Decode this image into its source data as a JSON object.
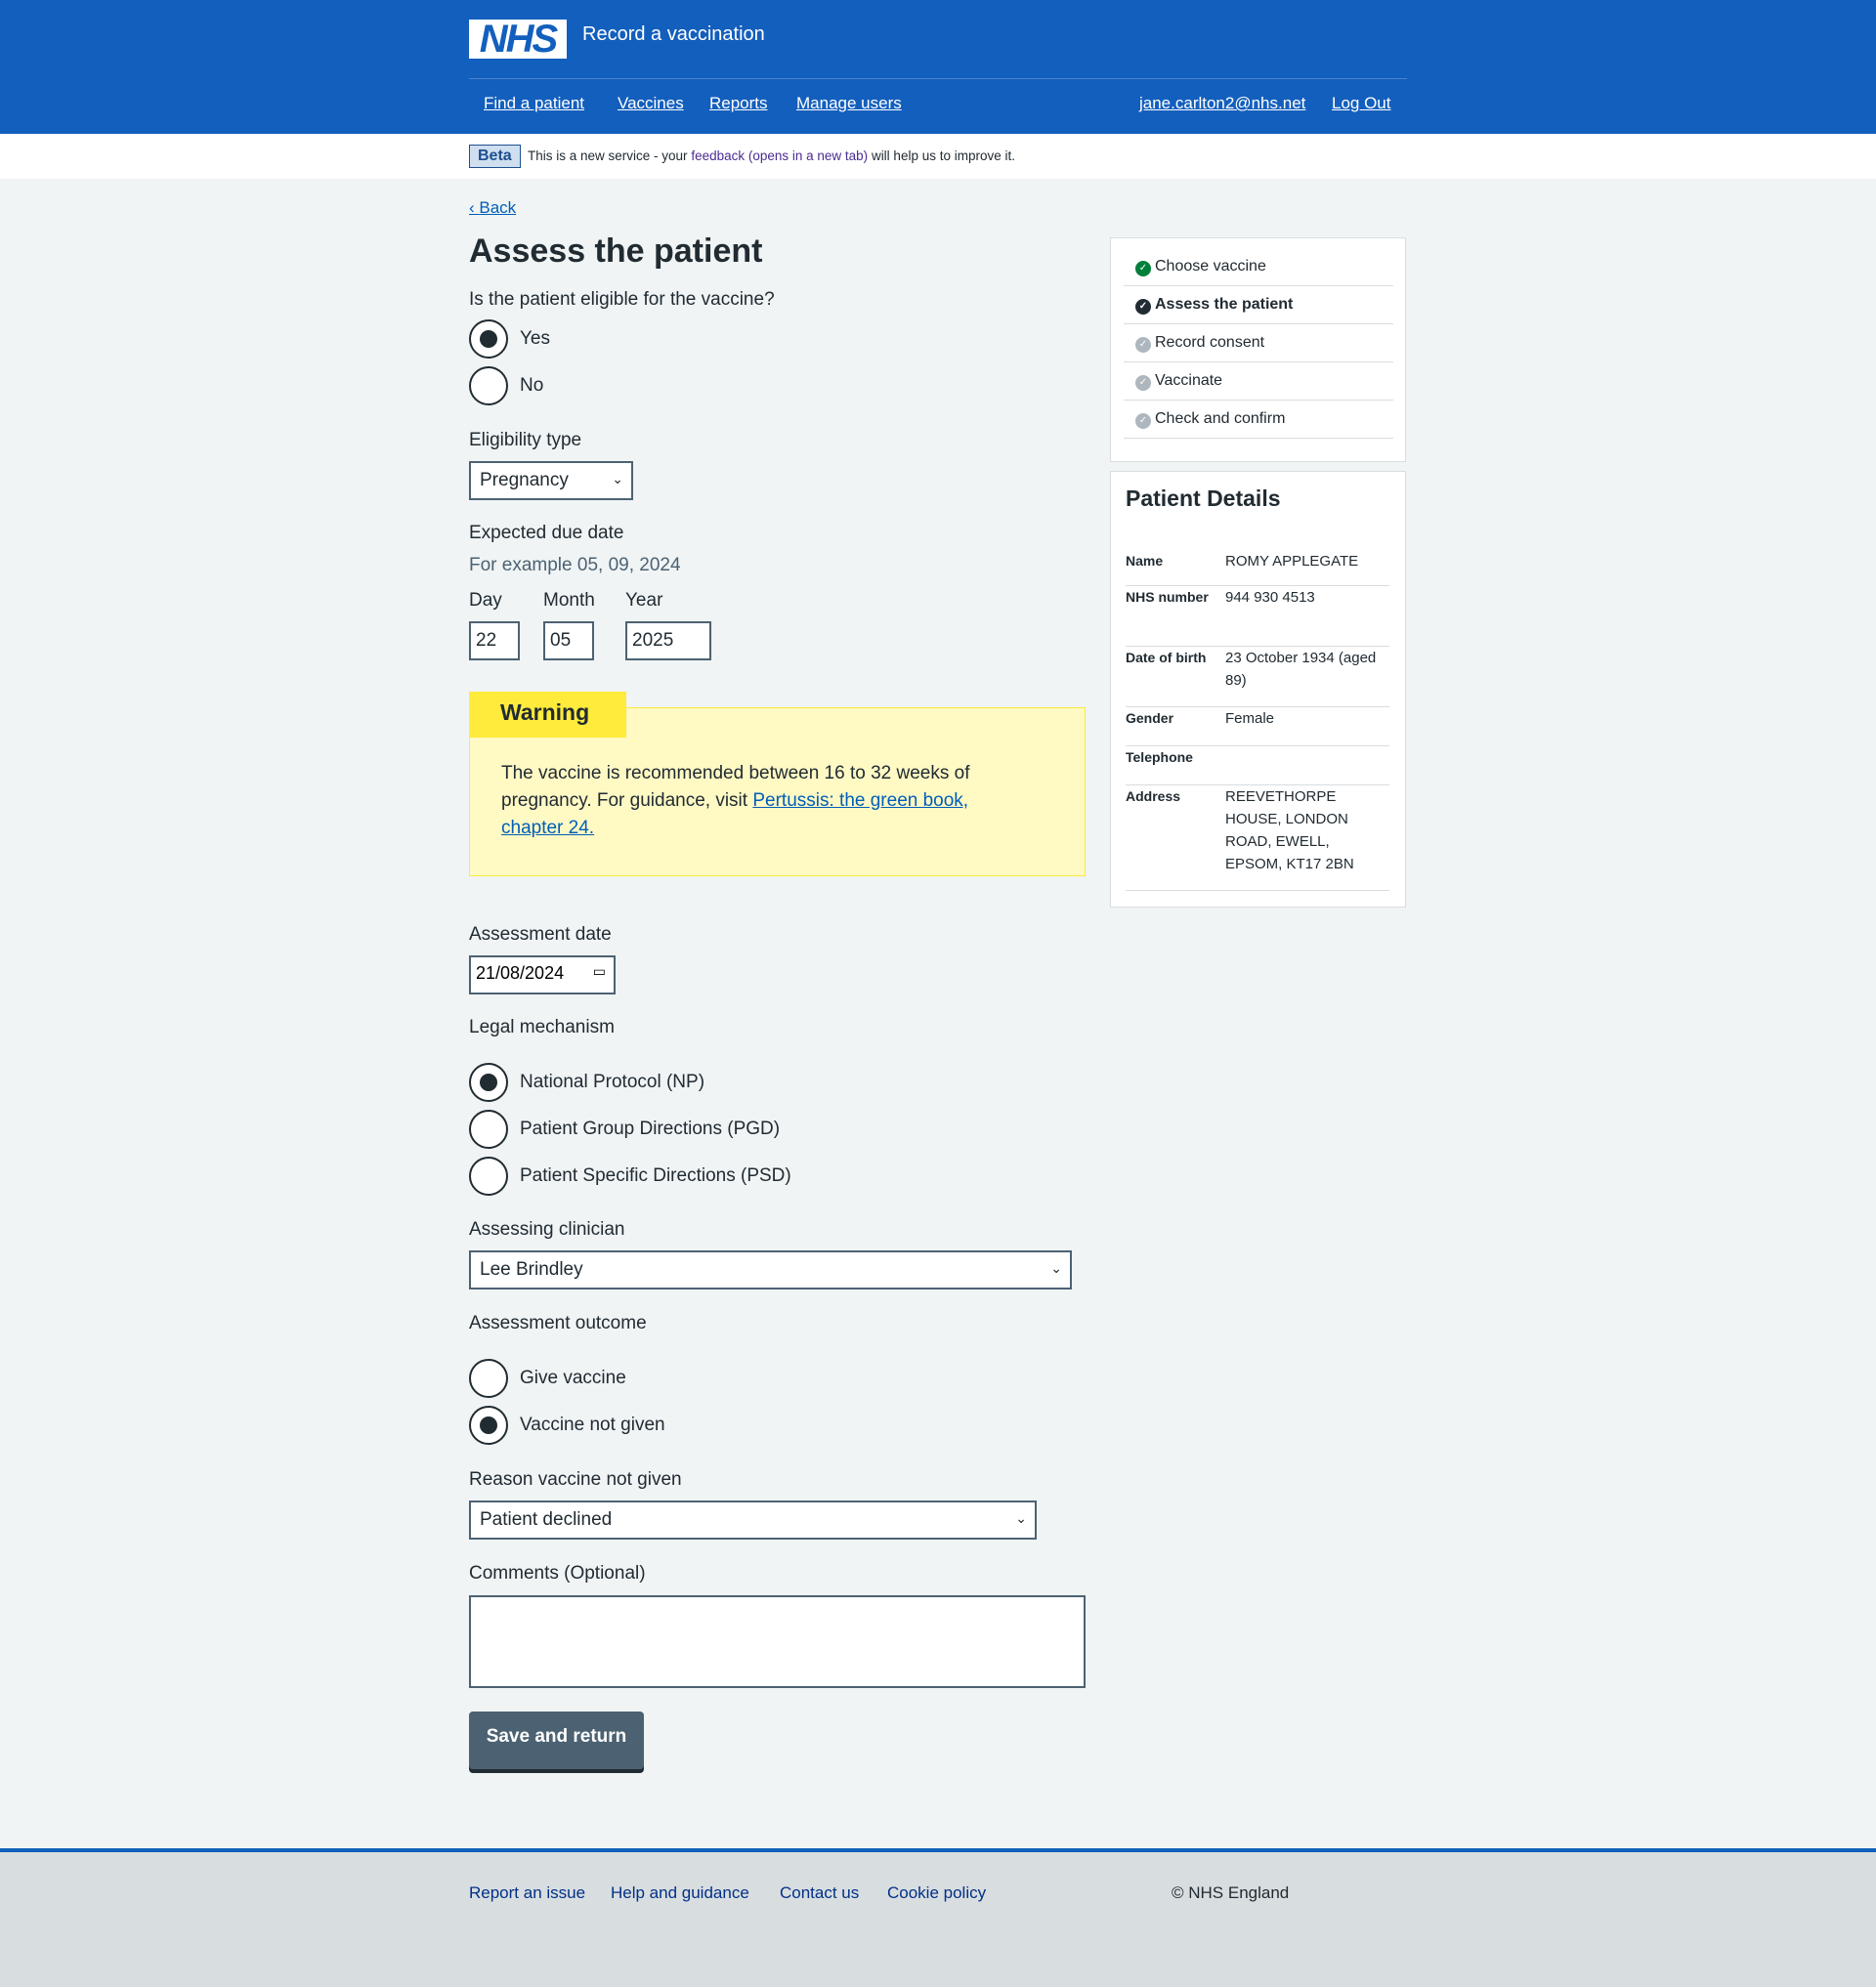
{
  "header": {
    "logo": "NHS",
    "service": "Record a vaccination",
    "nav": [
      "Find a patient",
      "Vaccines",
      "Reports",
      "Manage users"
    ],
    "user": "jane.carlton2@nhs.net",
    "logout": "Log Out"
  },
  "beta": {
    "tag": "Beta",
    "pre": "This is a new service - your ",
    "link": "feedback (opens in a new tab)",
    "post": " will help us to improve it."
  },
  "back": "Back",
  "title": "Assess the patient",
  "eligible": {
    "question": "Is the patient eligible for the vaccine?",
    "options": [
      "Yes",
      "No"
    ],
    "selected": "Yes"
  },
  "eligibility_type": {
    "label": "Eligibility type",
    "value": "Pregnancy"
  },
  "due_date": {
    "label": "Expected due date",
    "hint": "For example 05, 09, 2024",
    "day_label": "Day",
    "month_label": "Month",
    "year_label": "Year",
    "day": "22",
    "month": "05",
    "year": "2025"
  },
  "warning": {
    "title": "Warning",
    "text": "The vaccine is recommended between 16 to 32 weeks of pregnancy. For guidance, visit ",
    "link": "Pertussis: the green book, chapter 24."
  },
  "assessment_date": {
    "label": "Assessment date",
    "value": "21/08/2024"
  },
  "legal": {
    "label": "Legal mechanism",
    "options": [
      "National Protocol (NP)",
      "Patient Group Directions (PGD)",
      "Patient Specific Directions (PSD)"
    ],
    "selected": "National Protocol (NP)"
  },
  "clinician": {
    "label": "Assessing clinician",
    "value": "Lee Brindley"
  },
  "outcome": {
    "label": "Assessment outcome",
    "options": [
      "Give vaccine",
      "Vaccine not given"
    ],
    "selected": "Vaccine not given"
  },
  "reason": {
    "label": "Reason vaccine not given",
    "value": "Patient declined"
  },
  "comments": {
    "label": "Comments (Optional)",
    "value": ""
  },
  "save": "Save and return",
  "steps": [
    {
      "label": "Choose vaccine",
      "status": "done",
      "color": "#007f3b"
    },
    {
      "label": "Assess the patient",
      "status": "current",
      "color": "#212b32"
    },
    {
      "label": "Record consent",
      "status": "todo",
      "color": "#aeb7bd"
    },
    {
      "label": "Vaccinate",
      "status": "todo",
      "color": "#aeb7bd"
    },
    {
      "label": "Check and confirm",
      "status": "todo",
      "color": "#aeb7bd"
    }
  ],
  "patient": {
    "title": "Patient Details",
    "rows": [
      {
        "k": "Name",
        "v": "ROMY APPLEGATE"
      },
      {
        "k": "NHS number",
        "v": "944 930 4513"
      },
      {
        "k": "Date of birth",
        "v": "23 October 1934 (aged 89)"
      },
      {
        "k": "Gender",
        "v": "Female"
      },
      {
        "k": "Telephone",
        "v": ""
      },
      {
        "k": "Address",
        "v": "REEVETHORPE HOUSE, LONDON ROAD, EWELL, EPSOM, KT17 2BN"
      }
    ]
  },
  "footer": {
    "links": [
      "Report an issue",
      "Help and guidance",
      "Contact us",
      "Cookie policy"
    ],
    "copyright": "© NHS England"
  }
}
